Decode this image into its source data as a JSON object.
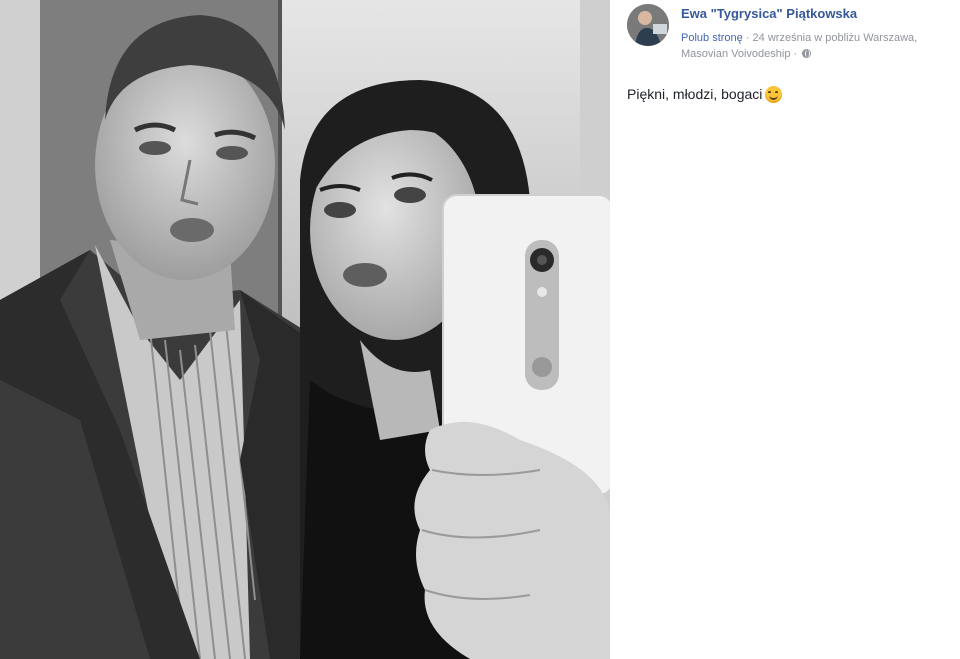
{
  "post": {
    "author_name": "Ewa \"Tygrysica\" Piątkowska",
    "like_page": "Polub stronę",
    "separator": " · ",
    "date_location": "24 września w pobliżu Warszawa, Masovian Voivodeship",
    "meta_separator": " · ",
    "caption": "Piękni, młodzi, bogaci",
    "caption_emoji": "smiling-face-icon",
    "privacy_icon": "globe-icon"
  }
}
